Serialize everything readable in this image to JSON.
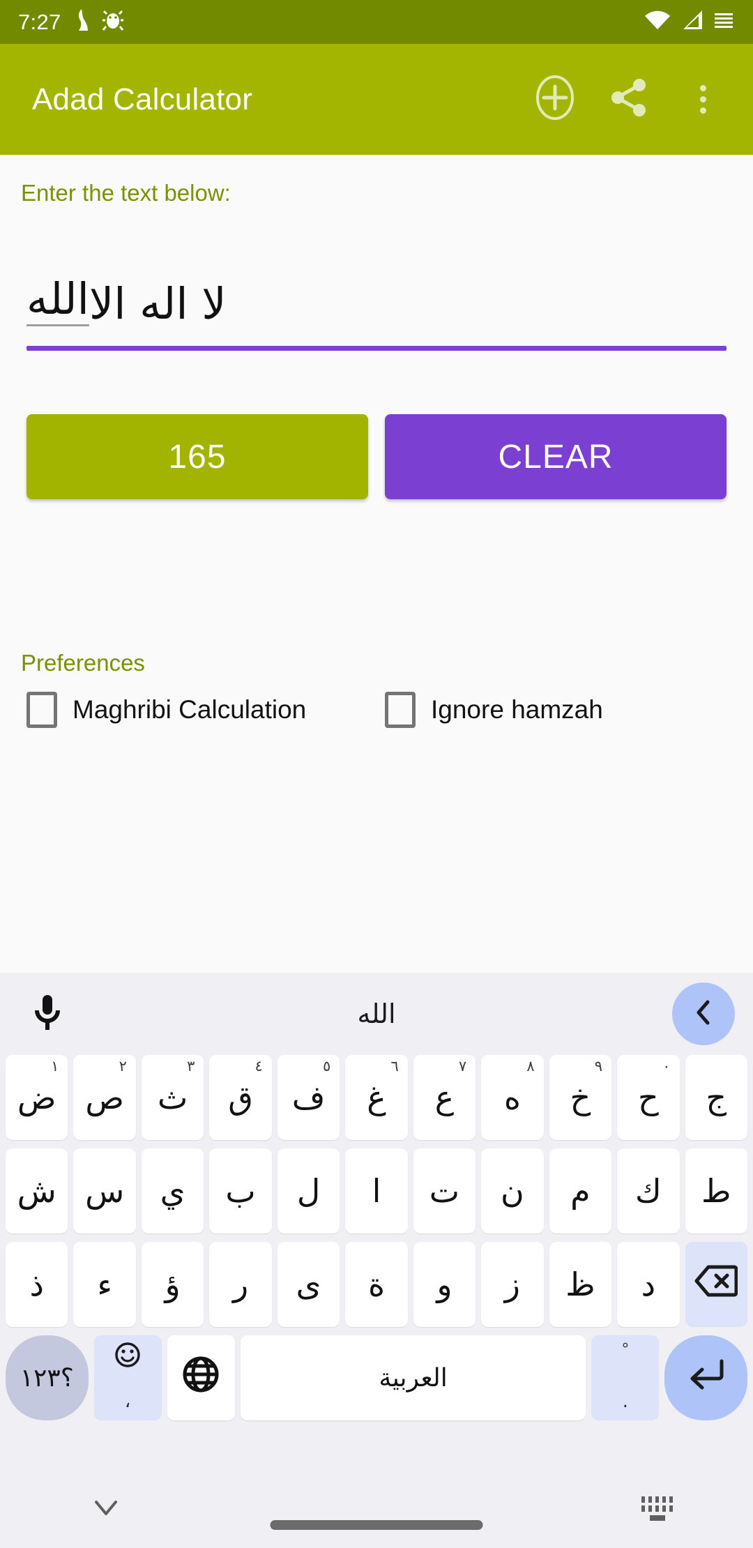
{
  "status_bar": {
    "time": "7:27",
    "left_icons": [
      "vibrate-icon",
      "bug-icon"
    ],
    "right_icons": [
      "wifi-icon",
      "cellular-signal-icon",
      "battery-icon"
    ],
    "background_color": "#718A00"
  },
  "app_bar": {
    "title": "Adad Calculator",
    "background_color": "#A4B500",
    "actions": [
      {
        "name": "add-circle-icon",
        "label": "Add"
      },
      {
        "name": "share-icon",
        "label": "Share"
      },
      {
        "name": "overflow-menu-icon",
        "label": "More options"
      }
    ]
  },
  "main": {
    "enter_label": "Enter the text below:",
    "input": {
      "value_prefix": "لا اله الا ",
      "value_composing": "الله",
      "full_value": "لا اله الا الله",
      "placeholder": "",
      "underline_color": "#7B3FD1"
    },
    "result_button": {
      "label": "165",
      "color": "#A2B300"
    },
    "clear_button": {
      "label": "CLEAR",
      "color": "#7B3FD1"
    },
    "preferences": {
      "title": "Preferences",
      "items": [
        {
          "label": "Maghribi Calculation",
          "checked": false
        },
        {
          "label": "Ignore hamzah",
          "checked": false
        }
      ]
    }
  },
  "keyboard": {
    "background_color": "#F0F0F4",
    "suggestion_bar": {
      "mic_icon": "microphone-icon",
      "suggestion": "الله",
      "expand_icon": "chevron-left-icon"
    },
    "row1": [
      {
        "key": "ض",
        "sup": "١"
      },
      {
        "key": "ص",
        "sup": "٢"
      },
      {
        "key": "ث",
        "sup": "٣"
      },
      {
        "key": "ق",
        "sup": "٤"
      },
      {
        "key": "ف",
        "sup": "٥"
      },
      {
        "key": "غ",
        "sup": "٦"
      },
      {
        "key": "ع",
        "sup": "٧"
      },
      {
        "key": "ه",
        "sup": "٨"
      },
      {
        "key": "خ",
        "sup": "٩"
      },
      {
        "key": "ح",
        "sup": "٠"
      },
      {
        "key": "ج",
        "sup": ""
      }
    ],
    "row2": [
      {
        "key": "ش"
      },
      {
        "key": "س"
      },
      {
        "key": "ي"
      },
      {
        "key": "ب"
      },
      {
        "key": "ل"
      },
      {
        "key": "ا"
      },
      {
        "key": "ت"
      },
      {
        "key": "ن"
      },
      {
        "key": "م"
      },
      {
        "key": "ك"
      },
      {
        "key": "ط"
      }
    ],
    "row3": [
      {
        "key": "ذ"
      },
      {
        "key": "ء"
      },
      {
        "key": "ؤ"
      },
      {
        "key": "ر"
      },
      {
        "key": "ى"
      },
      {
        "key": "ة"
      },
      {
        "key": "و"
      },
      {
        "key": "ز"
      },
      {
        "key": "ظ"
      },
      {
        "key": "د"
      },
      {
        "key": "backspace",
        "icon": "backspace-icon"
      }
    ],
    "row4": {
      "symbols_key": "؟١٢٣",
      "emoji_key": {
        "icon": "emoji-smiley-icon",
        "sub": "،"
      },
      "globe_key": {
        "icon": "globe-language-icon"
      },
      "space_key": "العربية",
      "period_key": {
        "label": ".",
        "top": "°"
      },
      "enter_key": {
        "icon": "enter-return-icon"
      }
    }
  },
  "nav_bar": {
    "hide_keyboard_icon": "chevron-down-icon",
    "gesture_pill": "home-gesture-pill",
    "keyboard_switch_icon": "keyboard-switcher-icon"
  }
}
